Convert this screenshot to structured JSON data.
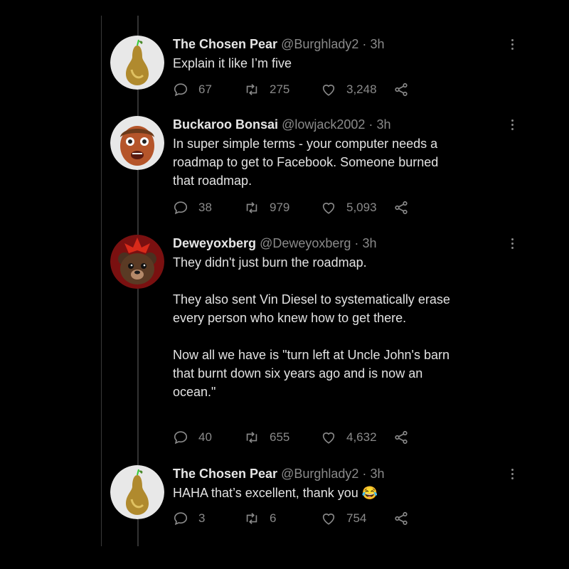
{
  "tweets": [
    {
      "name": "The Chosen Pear",
      "handle": "@Burghlady2",
      "separator": "·",
      "time": "3h",
      "text": [
        "Explain it like I’m five"
      ],
      "emoji": "",
      "replies": "67",
      "retweets": "275",
      "likes": "3,248",
      "avatar": "pear-avatar"
    },
    {
      "name": "Buckaroo Bonsai",
      "handle": "@lowjack2002",
      "separator": "·",
      "time": "3h",
      "text": [
        "In super simple terms - your computer needs a roadmap to get to Facebook. Someone burned that roadmap."
      ],
      "emoji": "",
      "replies": "38",
      "retweets": "979",
      "likes": "5,093",
      "avatar": "face-mask-avatar"
    },
    {
      "name": "Deweyoxberg",
      "handle": "@Deweyoxberg",
      "separator": "·",
      "time": "3h",
      "text": [
        "They didn't just burn the roadmap.",
        "They also sent Vin Diesel to systematically erase every person who knew how to get there.",
        "Now all we have is \"turn left at Uncle John's barn that burnt down six years ago and is now an ocean.\""
      ],
      "emoji": "",
      "replies": "40",
      "retweets": "655",
      "likes": "4,632",
      "avatar": "bear-avatar"
    },
    {
      "name": "The Chosen Pear",
      "handle": "@Burghlady2",
      "separator": "·",
      "time": "3h",
      "text": [
        "HAHA that’s excellent, thank you"
      ],
      "emoji": "😂",
      "replies": "3",
      "retweets": "6",
      "likes": "754",
      "avatar": "pear-avatar"
    }
  ],
  "colors": {
    "background": "#000000",
    "text": "#e2e2e2",
    "muted": "#8a8a8a",
    "thread_line": "#333333"
  },
  "icons": [
    "reply-icon",
    "retweet-icon",
    "like-icon",
    "share-icon",
    "more-icon"
  ]
}
